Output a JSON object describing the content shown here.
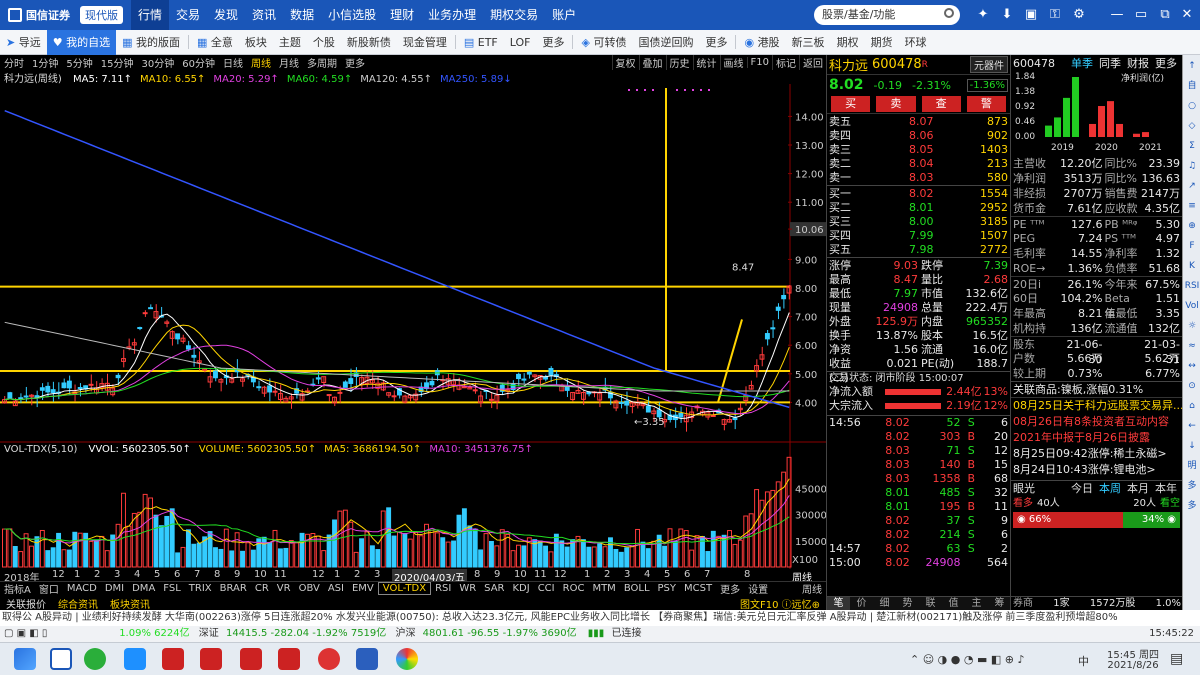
{
  "topbar": {
    "logo": "国信证券",
    "edition": "现代版",
    "menus": [
      "行情",
      "交易",
      "发现",
      "资讯",
      "数据",
      "小信选股",
      "理财",
      "业务办理",
      "期权交易",
      "账户"
    ],
    "search_placeholder": "股票/基金/功能"
  },
  "navbar": {
    "items": [
      "导远",
      "我的自选",
      "我的版面",
      "全意",
      "板块",
      "主题",
      "个股",
      "新股新债",
      "现金管理",
      "ETF",
      "LOF",
      "更多",
      "可转债",
      "国债逆回购",
      "更多",
      "港股",
      "新三板",
      "期权",
      "期货",
      "环球"
    ]
  },
  "periodbar": {
    "periods": [
      "分时",
      "1分钟",
      "5分钟",
      "15分钟",
      "30分钟",
      "60分钟",
      "日线",
      "周线",
      "月线",
      "多周期",
      "更多"
    ],
    "tools": [
      "复权",
      "叠加",
      "历史",
      "统计",
      "画线",
      "F10",
      "标记",
      "返回"
    ]
  },
  "ma_legend": {
    "title": "科力远(周线)",
    "items": [
      {
        "label": "MA5: 7.11↑",
        "color": "#ffffff"
      },
      {
        "label": "MA10: 6.55↑",
        "color": "#ffd400"
      },
      {
        "label": "MA20: 5.29↑",
        "color": "#e040e0"
      },
      {
        "label": "MA60: 4.59↑",
        "color": "#22dd22"
      },
      {
        "label": "MA120: 4.55↑",
        "color": "#cccccc"
      },
      {
        "label": "MA250: 5.89↓",
        "color": "#3355ff"
      }
    ]
  },
  "price_axis": {
    "ticks": [
      "14.00",
      "13.00",
      "12.00",
      "11.00",
      "10.06",
      "9.00",
      "8.00",
      "7.00",
      "6.00",
      "5.00",
      "4.00"
    ],
    "current": "10.06"
  },
  "price_annotations": {
    "high": "8.47",
    "low": "3.35"
  },
  "vol_legend": {
    "title": "VOL-TDX(5,10)",
    "items": [
      {
        "label": "VVOL: 5602305.50↑",
        "color": "#ffffff"
      },
      {
        "label": "VOLUME: 5602305.50↑",
        "color": "#ffd400"
      },
      {
        "label": "MA5: 3686194.50↑",
        "color": "#ffd400"
      },
      {
        "label": "MA10: 3451376.75↑",
        "color": "#e040e0"
      }
    ]
  },
  "vol_axis": {
    "ticks": [
      "45000",
      "30000",
      "15000"
    ],
    "unit": "X100"
  },
  "x_axis": {
    "labels": [
      "2018年",
      "12",
      "1",
      "2",
      "3",
      "4",
      "5",
      "6",
      "7",
      "8",
      "9",
      "10",
      "11",
      "12",
      "1",
      "2",
      "3",
      "4",
      "5",
      "6",
      "7",
      "8",
      "9",
      "10",
      "11",
      "12",
      "1",
      "2",
      "3",
      "4",
      "5",
      "6",
      "7",
      "8"
    ],
    "date": "2020/04/03/五",
    "period": "周线"
  },
  "bottom_tabs": [
    "指标A",
    "窗口",
    "MACD",
    "DMI",
    "DMA",
    "FSL",
    "TRIX",
    "BRAR",
    "CR",
    "VR",
    "OBV",
    "ASI",
    "EMV",
    "VOL-TDX",
    "RSI",
    "WR",
    "SAR",
    "KDJ",
    "CCI",
    "ROC",
    "MTM",
    "BOLL",
    "PSY",
    "MCST",
    "更多",
    "设置",
    "周线"
  ],
  "info_bar": {
    "left": [
      "关联报价",
      "综合资讯",
      "板块资讯"
    ],
    "right": "图文F10 ⓘ远忆⊕"
  },
  "quote": {
    "name": "科力远",
    "code": "600478",
    "badge": "R",
    "sector": "元器件",
    "sector_chg": "-1.36%",
    "price": "8.02",
    "change": "-0.19",
    "change_pct": "-2.31%",
    "buttons": [
      "买",
      "卖",
      "查",
      "警"
    ],
    "asks": [
      {
        "label": "卖五",
        "price": "8.07",
        "vol": "873"
      },
      {
        "label": "卖四",
        "price": "8.06",
        "vol": "902"
      },
      {
        "label": "卖三",
        "price": "8.05",
        "vol": "1403"
      },
      {
        "label": "卖二",
        "price": "8.04",
        "vol": "213"
      },
      {
        "label": "卖一",
        "price": "8.03",
        "vol": "580"
      }
    ],
    "bids": [
      {
        "label": "买一",
        "price": "8.02",
        "vol": "1554"
      },
      {
        "label": "买二",
        "price": "8.01",
        "vol": "2952"
      },
      {
        "label": "买三",
        "price": "8.00",
        "vol": "3185"
      },
      {
        "label": "买四",
        "price": "7.99",
        "vol": "1507"
      },
      {
        "label": "买五",
        "price": "7.98",
        "vol": "2772"
      }
    ],
    "stats": [
      {
        "l1": "涨停",
        "v1": "9.03",
        "l2": "跌停",
        "v2": "7.39",
        "c1": "red",
        "c2": "grn"
      },
      {
        "l1": "最高",
        "v1": "8.47",
        "l2": "量比",
        "v2": "2.68",
        "c1": "red",
        "c2": "red"
      },
      {
        "l1": "最低",
        "v1": "7.97",
        "l2": "市值",
        "v2": "132.6亿",
        "c1": "grn",
        "c2": "wht"
      },
      {
        "l1": "现量",
        "v1": "24908",
        "l2": "总量",
        "v2": "222.4万",
        "c1": "mag",
        "c2": "wht"
      },
      {
        "l1": "外盘",
        "v1": "125.9万",
        "l2": "内盘",
        "v2": "965352",
        "c1": "red",
        "c2": "grn"
      },
      {
        "l1": "换手",
        "v1": "13.87%",
        "l2": "股本",
        "v2": "16.5亿",
        "c1": "wht",
        "c2": "wht"
      },
      {
        "l1": "净资",
        "v1": "1.56",
        "l2": "流通",
        "v2": "16.0亿",
        "c1": "wht",
        "c2": "wht"
      },
      {
        "l1": "收益(二)",
        "v1": "0.021",
        "l2": "PE(动)",
        "v2": "188.7",
        "c1": "wht",
        "c2": "wht"
      }
    ],
    "status": "交易状态: 闭市阶段 15:00:07",
    "flows": [
      {
        "label": "净流入额",
        "value": "2.44亿",
        "pct": "13%"
      },
      {
        "label": "大宗流入",
        "value": "2.19亿",
        "pct": "12%"
      }
    ],
    "ticks": [
      {
        "time": "14:56",
        "price": "8.02",
        "vol": "52",
        "side": "S",
        "n": "6"
      },
      {
        "time": "",
        "price": "8.02",
        "vol": "303",
        "side": "B",
        "n": "20"
      },
      {
        "time": "",
        "price": "8.03",
        "vol": "71",
        "side": "S",
        "n": "12"
      },
      {
        "time": "",
        "price": "8.03",
        "vol": "140",
        "side": "B",
        "n": "15"
      },
      {
        "time": "",
        "price": "8.03",
        "vol": "1358",
        "side": "B",
        "n": "68"
      },
      {
        "time": "",
        "price": "8.01",
        "vol": "485",
        "side": "S",
        "n": "32"
      },
      {
        "time": "",
        "price": "8.01",
        "vol": "195",
        "side": "B",
        "n": "11"
      },
      {
        "time": "",
        "price": "8.02",
        "vol": "37",
        "side": "S",
        "n": "9"
      },
      {
        "time": "",
        "price": "8.02",
        "vol": "214",
        "side": "S",
        "n": "6"
      },
      {
        "time": "14:57",
        "price": "8.02",
        "vol": "63",
        "side": "S",
        "n": "2"
      },
      {
        "time": "15:00",
        "price": "8.02",
        "vol": "24908",
        "side": "",
        "n": "564"
      }
    ],
    "bottom_tabs": [
      "笔",
      "价",
      "细",
      "势",
      "联",
      "值",
      "主",
      "筹"
    ]
  },
  "fin": {
    "code": "600478",
    "tabs": [
      "单季",
      "同季",
      "财报",
      "更多"
    ],
    "chart_label": "净利润(亿)",
    "bars_left": {
      "years": [
        "2019",
        "2020",
        "2021"
      ],
      "ticks": [
        "1.84",
        "1.38",
        "0.92",
        "0.46",
        "0.00"
      ]
    },
    "rows": [
      {
        "l1": "主营收",
        "v1": "12.20亿",
        "l2": "同比%",
        "v2": "23.39"
      },
      {
        "l1": "净利润",
        "v1": "3513万",
        "l2": "同比%",
        "v2": "136.63"
      },
      {
        "l1": "非经损",
        "v1": "2707万",
        "l2": "销售费",
        "v2": "2147万"
      },
      {
        "l1": "货币金",
        "v1": "7.61亿",
        "l2": "应收款",
        "v2": "4.35亿"
      },
      {
        "l1": "PE ᵀᵀᴹ",
        "v1": "127.6",
        "l2": "PB ᴹᴿᵠ",
        "v2": "5.30"
      },
      {
        "l1": "PEG",
        "v1": "7.24",
        "l2": "PS ᵀᵀᴹ",
        "v2": "4.97"
      },
      {
        "l1": "毛利率",
        "v1": "14.55",
        "l2": "净利率",
        "v2": "1.32"
      },
      {
        "l1": "ROE→",
        "v1": "1.36%",
        "l2": "负债率",
        "v2": "51.68"
      },
      {
        "l1": "20日i",
        "v1": "26.1%",
        "l2": "今年来",
        "v2": "67.5%"
      },
      {
        "l1": "60日",
        "v1": "104.2%",
        "l2": "Beta值",
        "v2": "1.51"
      },
      {
        "l1": "年最高",
        "v1": "8.21",
        "l2": "年最低",
        "v2": "3.35"
      },
      {
        "l1": "机构持",
        "v1": "136亿",
        "l2": "流通值",
        "v2": "132亿"
      },
      {
        "l1": "股东",
        "v1": "21-06-30",
        "l2": "",
        "v2": "21-03-31"
      },
      {
        "l1": "户数",
        "v1": "5.66万",
        "l2": "",
        "v2": "5.62万"
      },
      {
        "l1": "较上期",
        "v1": "0.73%",
        "l2": "",
        "v2": "6.77%"
      }
    ],
    "related": "关联商品:镍板,涨幅0.31%",
    "news": [
      {
        "text": "08月25日关于科力远股票交易异...",
        "color": "#ffd400"
      },
      {
        "text": "08月26日有8条投资者互动内容",
        "color": "#ff3b3b"
      },
      {
        "text": "2021年中报于8月26日披露",
        "color": "#ff3b3b"
      },
      {
        "text": "8月25日09:42涨停:稀土永磁>",
        "color": "#e8e8e8"
      },
      {
        "text": "8月24日10:43涨停:锂电池>",
        "color": "#e8e8e8"
      }
    ],
    "vision": {
      "title": "眼光",
      "tabs": [
        "今日",
        "本周",
        "本月",
        "本年"
      ],
      "bull_label": "看多",
      "bull_n": "40人",
      "bear_n": "20人",
      "bear_label": "看空",
      "bull_pct": "66%",
      "bear_pct": "34%"
    },
    "bottom": {
      "l": "券商",
      "v1": "1家",
      "v2": "1572万股",
      "v3": "1.0%"
    }
  },
  "sidebar": [
    "↑",
    "自",
    "○",
    "◇",
    "Σ",
    "♫",
    "↗",
    "≡",
    "⊕",
    "F",
    "K",
    "RSI",
    "Vol",
    "☼",
    "≈",
    "↔",
    "⊙",
    "⌂",
    "←",
    "↓",
    "明",
    "多",
    "多"
  ],
  "ticker": "取得公   A股异动 | 业绩利好持续发酵 大华南(002263)涨停 5日连涨超20%      水发兴业能源(00750): 总收入达23.3亿元, 风能EPC业务收入同比增长      【券商聚焦】瑞信:美元兑日元汇率反弹      A股异动 | 楚江新材(002171)触及涨停 前三季度盈利预增超80%",
  "indexbar": {
    "sh": "1.09% 6224亿",
    "sz_label": "深证",
    "sz": "14415.5 -282.04 -1.92% 7519亿",
    "hs_label": "沪深",
    "hs": "4801.61 -96.55 -1.97% 3690亿",
    "conn": "已连接",
    "time": "15:45:22"
  },
  "taskbar": {
    "time": "15:45 周四",
    "date": "2021/8/26",
    "lang": "中"
  },
  "colors": {
    "up": "#ff3b3b",
    "down": "#22dd22",
    "cyan": "#33ccff",
    "yellow": "#ffd400",
    "brand": "#1a56b8"
  }
}
